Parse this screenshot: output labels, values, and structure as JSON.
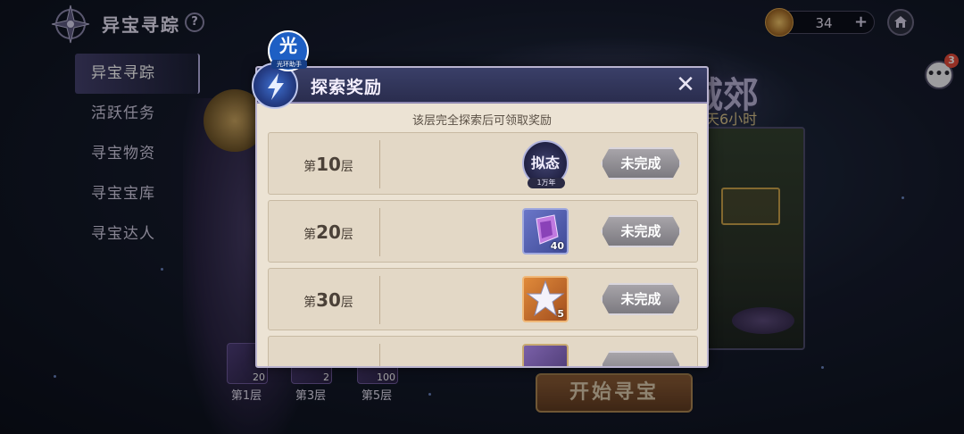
{
  "header": {
    "title": "异宝寻踪",
    "help_label": "?",
    "currency_value": "34",
    "currency_add_label": "+",
    "home_icon": "home-icon"
  },
  "nav": {
    "items": [
      {
        "label": "异宝寻踪",
        "active": true
      },
      {
        "label": "活跃任务",
        "active": false
      },
      {
        "label": "寻宝物资",
        "active": false
      },
      {
        "label": "寻宝宝库",
        "active": false
      },
      {
        "label": "寻宝达人",
        "active": false
      }
    ]
  },
  "background": {
    "banner_text": "城郊",
    "banner_sub": "天6小时"
  },
  "chat": {
    "badge_count": "3"
  },
  "bottom": {
    "floors": [
      {
        "label": "第1层",
        "count": "20"
      },
      {
        "label": "第3层",
        "count": "2"
      },
      {
        "label": "第5层",
        "count": "100"
      }
    ],
    "start_label": "开始寻宝"
  },
  "modal": {
    "title": "探索奖励",
    "assistant_glyph": "光",
    "assistant_sub": "光环助手",
    "subtitle": "该层完全探索后可领取奖励",
    "close_label": "✕",
    "rows": [
      {
        "prefix": "第",
        "num": "10",
        "suffix": "层",
        "reward_name": "拟态",
        "reward_tag": "1万年",
        "reward_qty": "",
        "status": "未完成"
      },
      {
        "prefix": "第",
        "num": "20",
        "suffix": "层",
        "reward_name": "",
        "reward_tag": "",
        "reward_qty": "40",
        "status": "未完成"
      },
      {
        "prefix": "第",
        "num": "30",
        "suffix": "层",
        "reward_name": "",
        "reward_tag": "",
        "reward_qty": "5",
        "status": "未完成"
      },
      {
        "prefix": "",
        "num": "",
        "suffix": "",
        "reward_name": "",
        "reward_tag": "",
        "reward_qty": "",
        "status": ""
      }
    ]
  },
  "colors": {
    "accent": "#3a3f68",
    "panel": "#ece3d4",
    "status_button": "#8f8d93"
  }
}
